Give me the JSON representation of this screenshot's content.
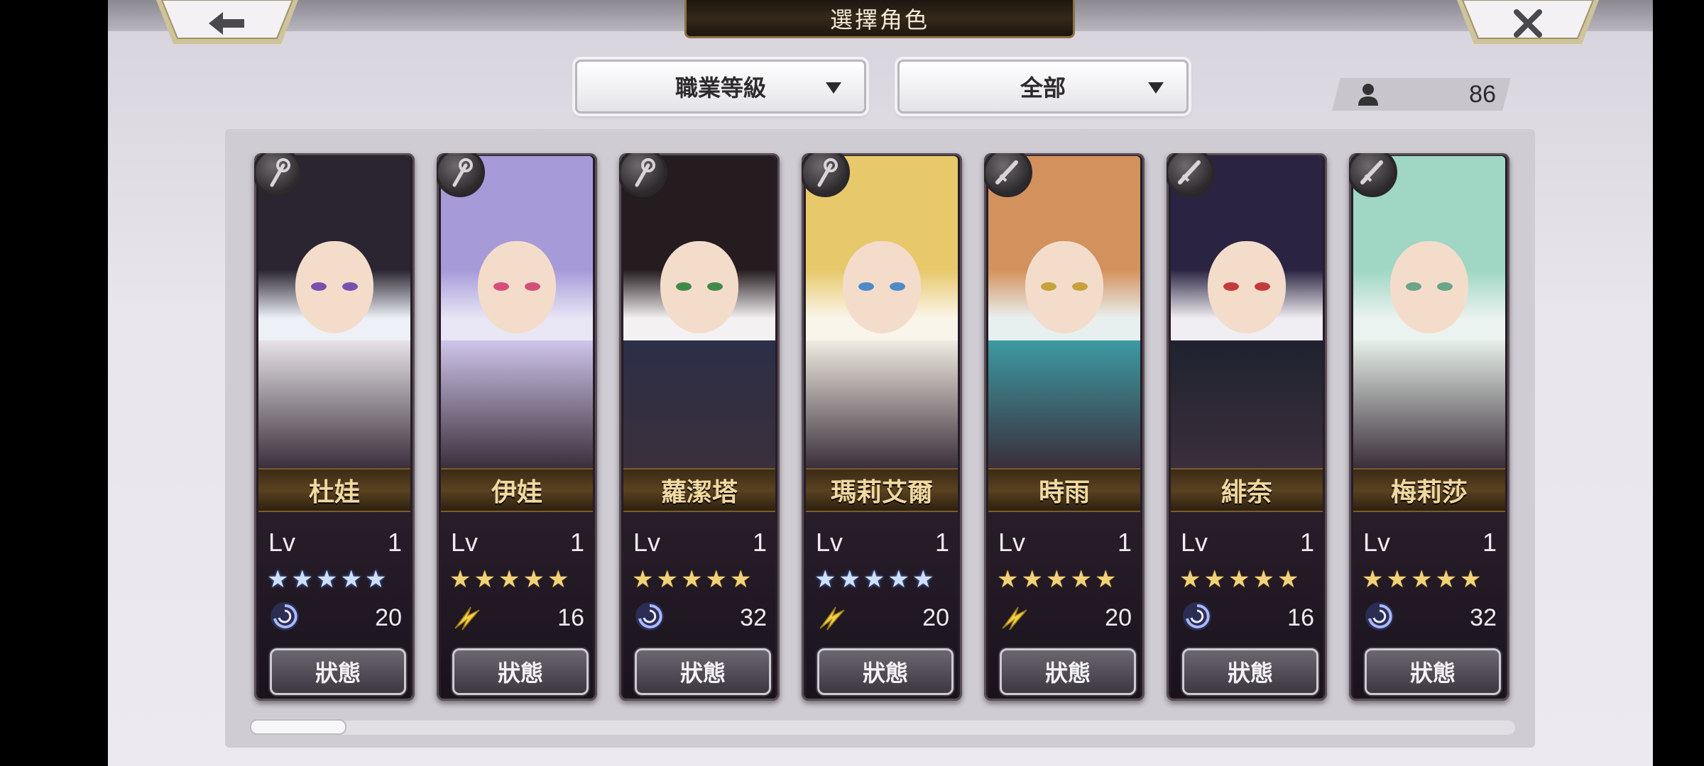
{
  "header": {
    "title": "選擇角色",
    "back_icon": "arrow-left-icon",
    "close_icon": "close-x-icon"
  },
  "filters": {
    "sort": {
      "label": "職業等級"
    },
    "category": {
      "label": "全部"
    }
  },
  "party_count": {
    "icon": "person-icon",
    "value": "86"
  },
  "characters": [
    {
      "name": "杜娃",
      "lv_label": "Lv",
      "level": "1",
      "stars": 5,
      "star_type": "blue",
      "element": "wind",
      "value": "20",
      "status_label": "狀態",
      "class_icon": "staff"
    },
    {
      "name": "伊娃",
      "lv_label": "Lv",
      "level": "1",
      "stars": 5,
      "star_type": "gold",
      "element": "lightning",
      "value": "16",
      "status_label": "狀態",
      "class_icon": "staff"
    },
    {
      "name": "蘿潔塔",
      "lv_label": "Lv",
      "level": "1",
      "stars": 5,
      "star_type": "gold",
      "element": "wind",
      "value": "32",
      "status_label": "狀態",
      "class_icon": "staff"
    },
    {
      "name": "瑪莉艾爾",
      "lv_label": "Lv",
      "level": "1",
      "stars": 5,
      "star_type": "blue",
      "element": "lightning",
      "value": "20",
      "status_label": "狀態",
      "class_icon": "staff"
    },
    {
      "name": "時雨",
      "lv_label": "Lv",
      "level": "1",
      "stars": 5,
      "star_type": "gold",
      "element": "lightning",
      "value": "20",
      "status_label": "狀態",
      "class_icon": "sword"
    },
    {
      "name": "緋奈",
      "lv_label": "Lv",
      "level": "1",
      "stars": 5,
      "star_type": "gold",
      "element": "wind",
      "value": "16",
      "status_label": "狀態",
      "class_icon": "sword"
    },
    {
      "name": "梅莉莎",
      "lv_label": "Lv",
      "level": "1",
      "stars": 5,
      "star_type": "gold",
      "element": "wind",
      "value": "32",
      "status_label": "狀態",
      "class_icon": "sword"
    }
  ],
  "colors": {
    "accent_gold": "#f1d8a0",
    "star_gold": "#f1d27a",
    "star_blue": "#cfe0ff",
    "wind": "#8fa6ff",
    "lightning": "#f3cf45"
  }
}
